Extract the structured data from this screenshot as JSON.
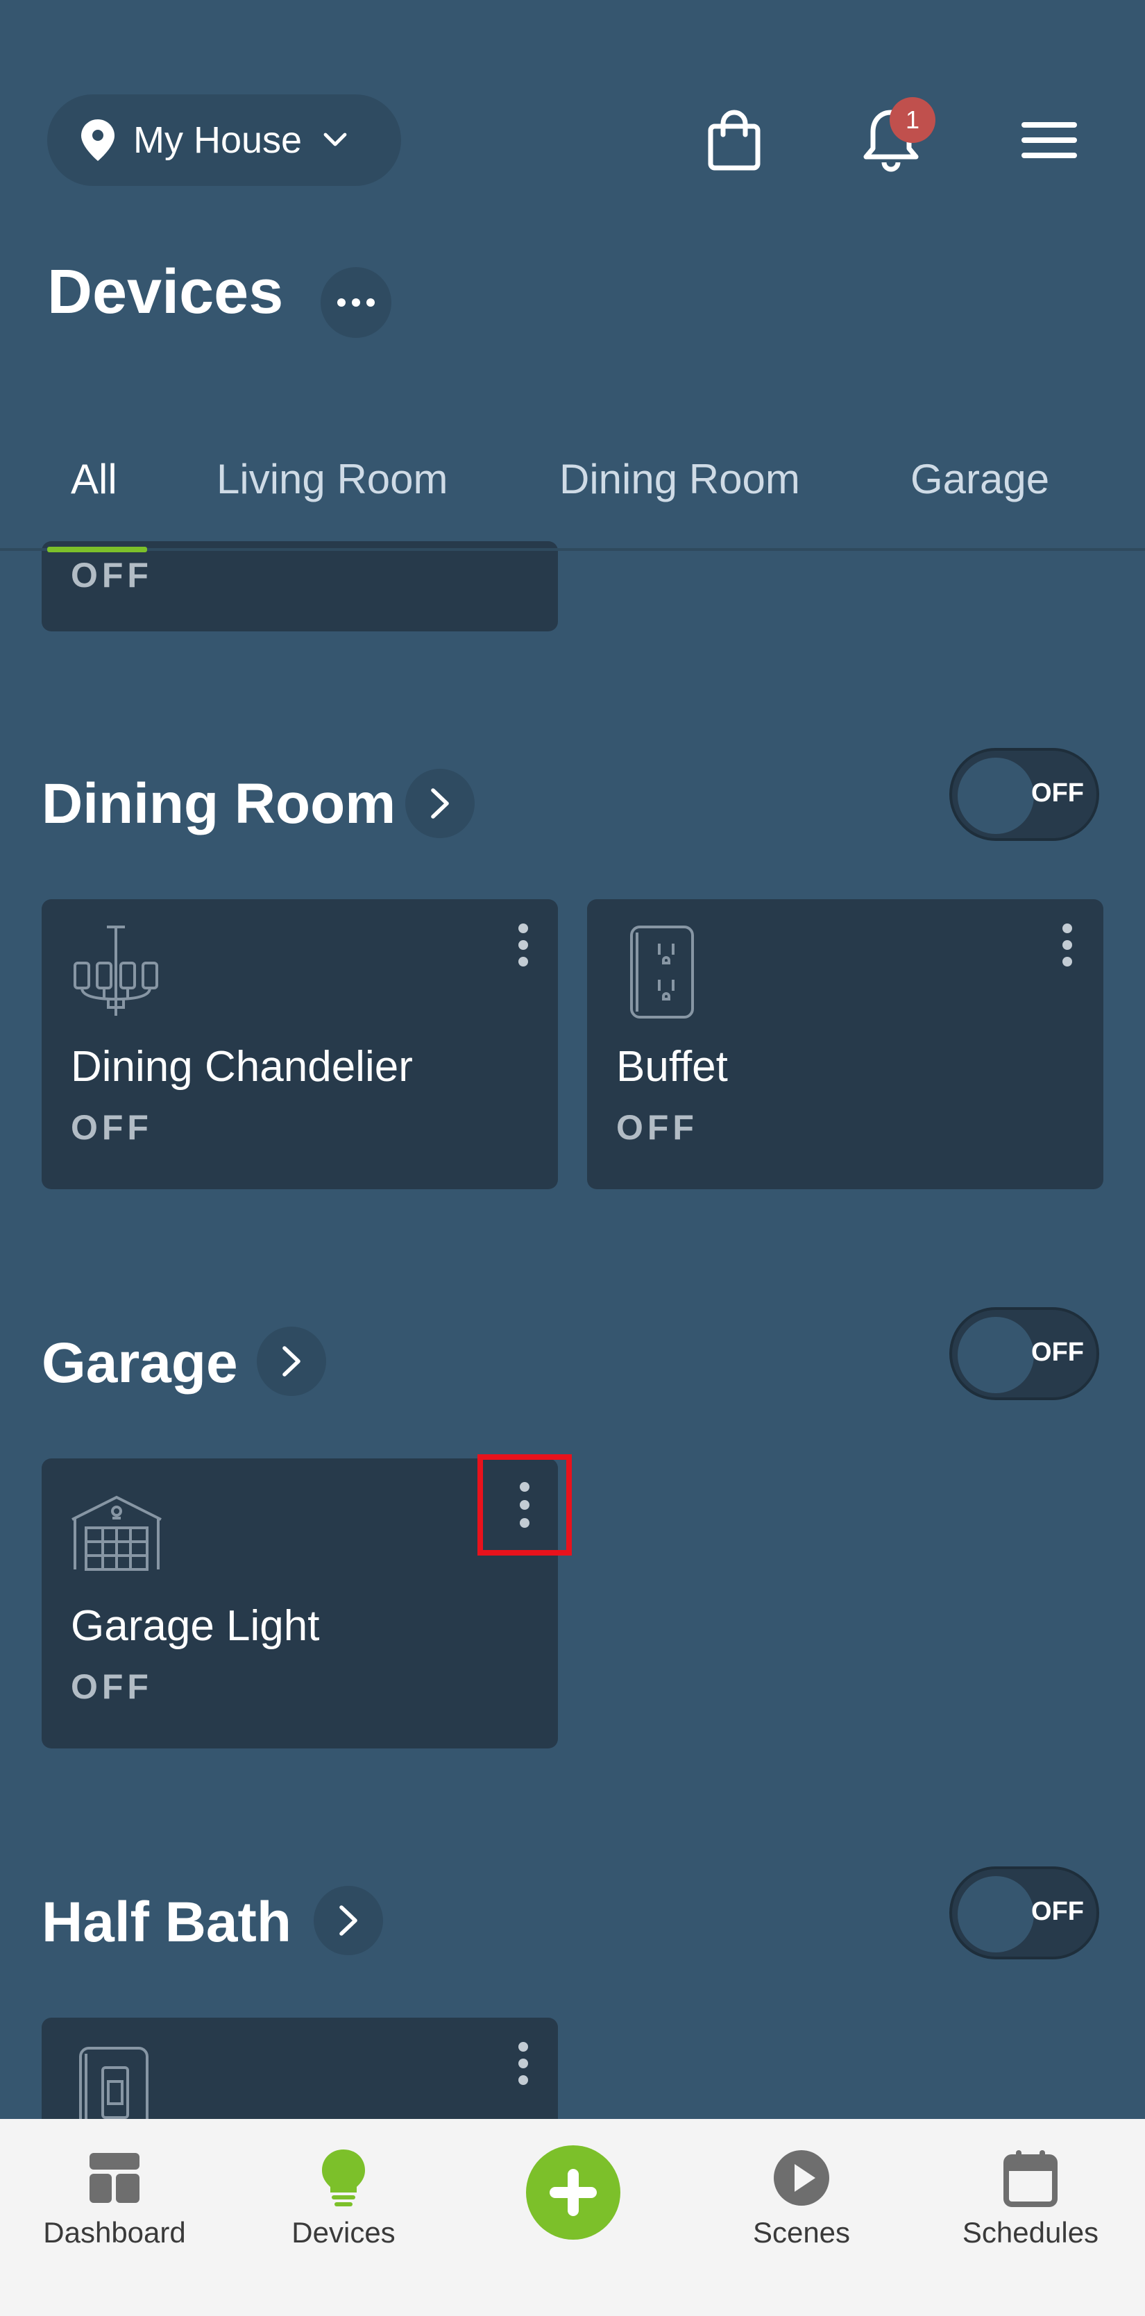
{
  "header": {
    "location_label": "My House",
    "notification_count": "1",
    "page_title": "Devices"
  },
  "tabs": [
    {
      "label": "All",
      "active": true
    },
    {
      "label": "Living Room",
      "active": false
    },
    {
      "label": "Dining Room",
      "active": false
    },
    {
      "label": "Garage",
      "active": false
    }
  ],
  "partial_card": {
    "state": "OFF"
  },
  "sections": [
    {
      "title": "Dining Room",
      "toggle_label": "OFF",
      "devices": [
        {
          "name": "Dining Chandelier",
          "state": "OFF",
          "icon": "chandelier-icon"
        },
        {
          "name": "Buffet",
          "state": "OFF",
          "icon": "outlet-icon"
        }
      ]
    },
    {
      "title": "Garage",
      "toggle_label": "OFF",
      "devices": [
        {
          "name": "Garage Light",
          "state": "OFF",
          "icon": "garage-icon"
        }
      ]
    },
    {
      "title": "Half Bath",
      "toggle_label": "OFF",
      "devices": [
        {
          "icon": "light-switch-icon"
        }
      ]
    }
  ],
  "bottom_nav": {
    "dashboard": "Dashboard",
    "devices": "Devices",
    "scenes": "Scenes",
    "schedules": "Schedules"
  },
  "colors": {
    "background": "#36566f",
    "card": "#273a4b",
    "accent": "#7cc02a",
    "highlight": "#e8121c",
    "badge": "#c0504d"
  }
}
